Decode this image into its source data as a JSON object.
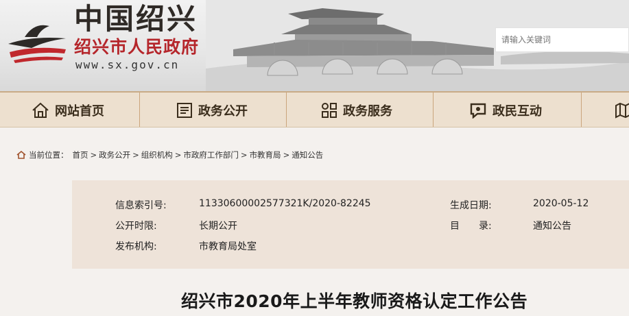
{
  "site": {
    "name": "中国绍兴",
    "subtitle": "绍兴市人民政府",
    "url": "www.sx.gov.cn"
  },
  "search": {
    "placeholder": "请输入关键词"
  },
  "nav": {
    "items": [
      {
        "label": "网站首页",
        "icon": "home-icon"
      },
      {
        "label": "政务公开",
        "icon": "document-icon"
      },
      {
        "label": "政务服务",
        "icon": "grid-icon"
      },
      {
        "label": "政民互动",
        "icon": "chat-icon"
      },
      {
        "label": "",
        "icon": "map-icon"
      }
    ]
  },
  "breadcrumb": {
    "prefix": "当前位置：",
    "items": [
      "首页",
      "政务公开",
      "组织机构",
      "市政府工作部门",
      "市教育局",
      "通知公告"
    ],
    "separator": ">"
  },
  "info": {
    "index_label": "信息索引号:",
    "index_value": "11330600002577321K/2020-82245",
    "date_label": "生成日期:",
    "date_value": "2020-05-12",
    "period_label": "公开时限:",
    "period_value": "长期公开",
    "catalog_label": "目　　录:",
    "catalog_value": "通知公告",
    "publisher_label": "发布机构:",
    "publisher_value": "市教育局处室"
  },
  "article": {
    "title": "绍兴市2020年上半年教师资格认定工作公告"
  },
  "colors": {
    "nav_bg": "#ede0cf",
    "nav_border": "#caa57c",
    "info_bg": "#eee3d9",
    "brand_red": "#b5262b",
    "page_bg": "#f4f1ee"
  }
}
